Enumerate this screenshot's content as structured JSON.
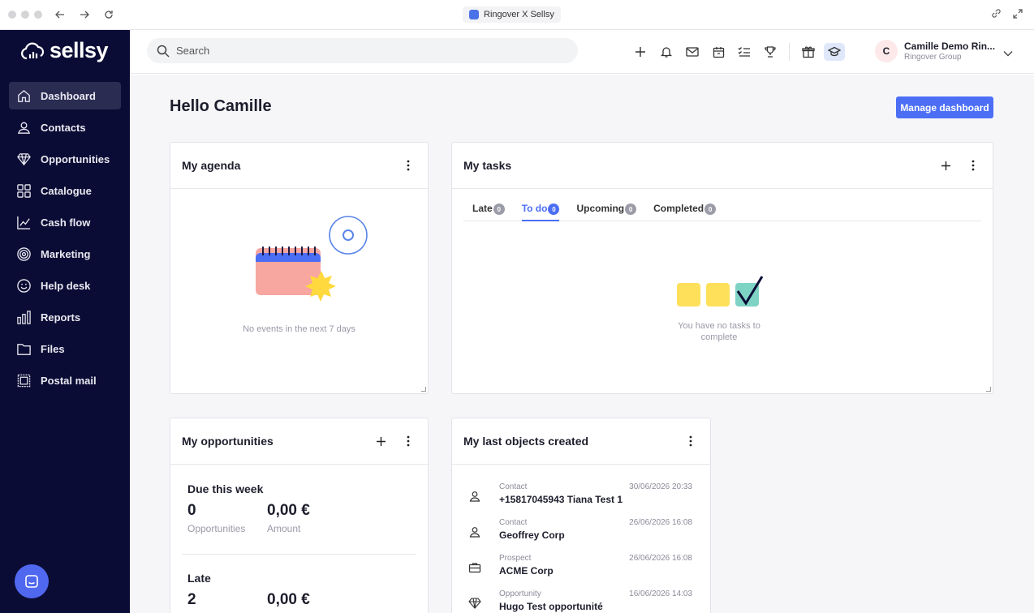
{
  "browser": {
    "tab_title": "Ringover X Sellsy"
  },
  "brand": {
    "name": "sellsy",
    "sidebar_bg": "#0b0c35",
    "accent": "#4b6ef5"
  },
  "sidebar": {
    "items": [
      {
        "label": "Dashboard",
        "icon": "home-icon",
        "active": true
      },
      {
        "label": "Contacts",
        "icon": "person-icon"
      },
      {
        "label": "Opportunities",
        "icon": "diamond-icon"
      },
      {
        "label": "Catalogue",
        "icon": "grid-icon"
      },
      {
        "label": "Cash flow",
        "icon": "chart-line-icon"
      },
      {
        "label": "Marketing",
        "icon": "target-icon"
      },
      {
        "label": "Help desk",
        "icon": "smiley-icon"
      },
      {
        "label": "Reports",
        "icon": "bar-chart-icon"
      },
      {
        "label": "Files",
        "icon": "folder-icon"
      },
      {
        "label": "Postal mail",
        "icon": "stamp-icon"
      }
    ]
  },
  "topbar": {
    "search_placeholder": "Search",
    "icons": [
      "plus-icon",
      "bell-icon",
      "mail-icon",
      "calendar-icon",
      "checklist-icon",
      "trophy-icon",
      "gift-icon",
      "graduation-cap-icon"
    ],
    "user": {
      "initial": "C",
      "name": "Camille Demo Rin...",
      "company": "Ringover Group"
    }
  },
  "main": {
    "greeting": "Hello Camille",
    "manage_button": "Manage dashboard",
    "agenda": {
      "title": "My agenda",
      "empty": "No events in the next 7 days"
    },
    "tasks": {
      "title": "My tasks",
      "tabs": [
        {
          "label": "Late",
          "count": "0"
        },
        {
          "label": "To do",
          "count": "0",
          "active": true
        },
        {
          "label": "Upcoming",
          "count": "0"
        },
        {
          "label": "Completed",
          "count": "0"
        }
      ],
      "empty_line1": "You have no tasks to",
      "empty_line2": "complete"
    },
    "opportunities": {
      "title": "My opportunities",
      "sections": [
        {
          "heading": "Due this week",
          "count": "0",
          "count_label": "Opportunities",
          "amount": "0,00 €",
          "amount_label": "Amount"
        },
        {
          "heading": "Late",
          "count": "2",
          "amount": "0,00 €"
        }
      ]
    },
    "last_objects": {
      "title": "My last objects created",
      "rows": [
        {
          "type": "Contact",
          "date": "30/06/2026 20:33",
          "name": "+15817045943 Tiana Test 1",
          "icon": "person-icon"
        },
        {
          "type": "Contact",
          "date": "26/06/2026 16:08",
          "name": "Geoffrey Corp",
          "icon": "person-icon"
        },
        {
          "type": "Prospect",
          "date": "26/06/2026 16:08",
          "name": "ACME Corp",
          "icon": "briefcase-icon"
        },
        {
          "type": "Opportunity",
          "date": "16/06/2026 14:03",
          "name": "Hugo Test opportunité",
          "icon": "diamond-icon"
        }
      ]
    }
  }
}
